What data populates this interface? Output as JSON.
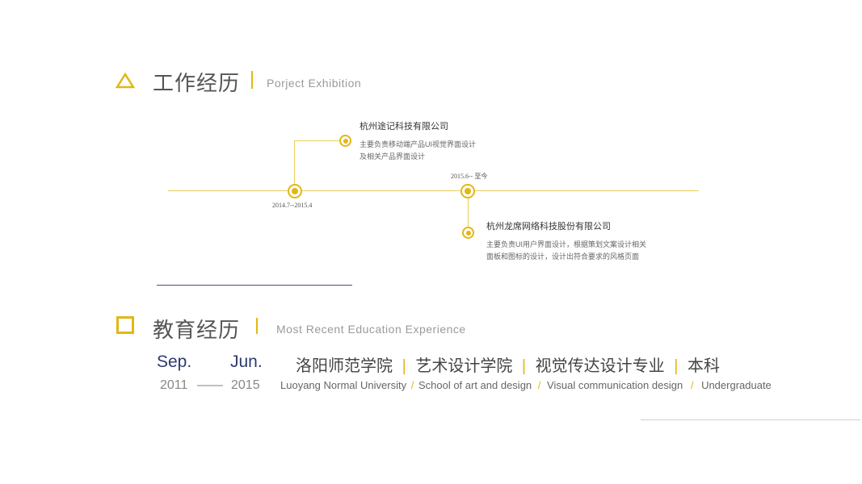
{
  "work": {
    "title_cn": "工作经历",
    "title_en": "Porject  Exhibition",
    "entries": [
      {
        "company": "杭州途记科技有限公司",
        "desc_line1": "主要负责移动端产品UI视觉界面设计",
        "desc_line2": "及相关产品界面设计",
        "date": "2014.7--2015.4"
      },
      {
        "company": "杭州龙席网络科技股份有限公司",
        "desc_line1": "主要负责UI用户界面设计，根据策划文案设计相关",
        "desc_line2": "面板和图标的设计，设计出符合要求的风格页面",
        "date": "2015.6-- 至今"
      }
    ]
  },
  "education": {
    "title_cn": "教育经历",
    "title_en": "Most  Recent  Education  Experience",
    "start_month": "Sep.",
    "end_month": "Jun.",
    "start_year": "2011",
    "year_dash": "——",
    "end_year": "2015",
    "separator": "|",
    "en_separator": "/",
    "school_cn": "洛阳师范学院",
    "college_cn": "艺术设计学院",
    "major_cn": "视觉传达设计专业",
    "degree_cn": "本科",
    "school_en": "Luoyang Normal University",
    "college_en": "School of art and design",
    "major_en": "Visual communication design",
    "degree_en": "Undergraduate"
  },
  "colors": {
    "accent": "#e2b714",
    "navy": "#2e3a6e",
    "text": "#555555"
  },
  "icons": {
    "work": "triangle-outline-icon",
    "education": "square-outline-icon"
  }
}
